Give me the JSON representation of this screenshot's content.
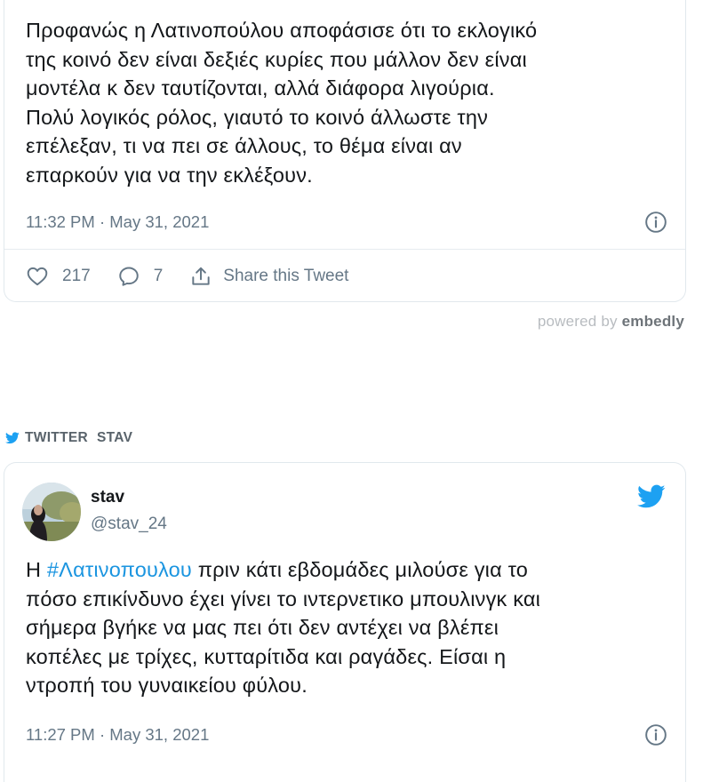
{
  "tweet1": {
    "lines": [
      "Προφανώς η Λατινοπούλου αποφάσισε ότι το εκλογικό",
      "της κοινό δεν είναι δεξιές κυρίες που μάλλον δεν είναι",
      "μοντέλα κ δεν ταυτίζονται, αλλά διάφορα λιγούρια.",
      "Πολύ λογικός ρόλος, γιαυτό το κοινό άλλωστε την",
      "επέλεξαν, τι να πει σε άλλους, το θέμα είναι αν",
      "επαρκούν για να την εκλέξουν."
    ],
    "timestamp": "11:32 PM · May 31, 2021",
    "likes": "217",
    "replies": "7",
    "share_label": "Share this Tweet"
  },
  "embedly": {
    "prefix": "powered by ",
    "brand": "embedly"
  },
  "source": {
    "platform": "TWITTER",
    "account": "STAV"
  },
  "tweet2": {
    "name": "stav",
    "handle": "@stav_24",
    "line1_prefix": "Η ",
    "hashtag": "#Λατινοπουλου",
    "line1_suffix": " πριν κάτι εβδομάδες μιλούσε για το",
    "lines": [
      "πόσο επικίνδυνο έχει γίνει το ιντερνετικο μπουλινγκ και",
      "σήμερα βγήκε να μας πει ότι δεν αντέχει να βλέπει",
      "κοπέλες με τρίχες, κυτταρίτιδα και ραγάδες. Είσαι η",
      "ντροπή του γυναικείου φύλου."
    ],
    "timestamp": "11:27 PM · May 31, 2021"
  },
  "colors": {
    "twitter_blue": "#1da1f2",
    "hashtag": "#1b95e0",
    "muted": "#657786"
  },
  "icons": [
    "heart-icon",
    "reply-icon",
    "share-icon",
    "info-icon",
    "twitter-bird-icon"
  ]
}
